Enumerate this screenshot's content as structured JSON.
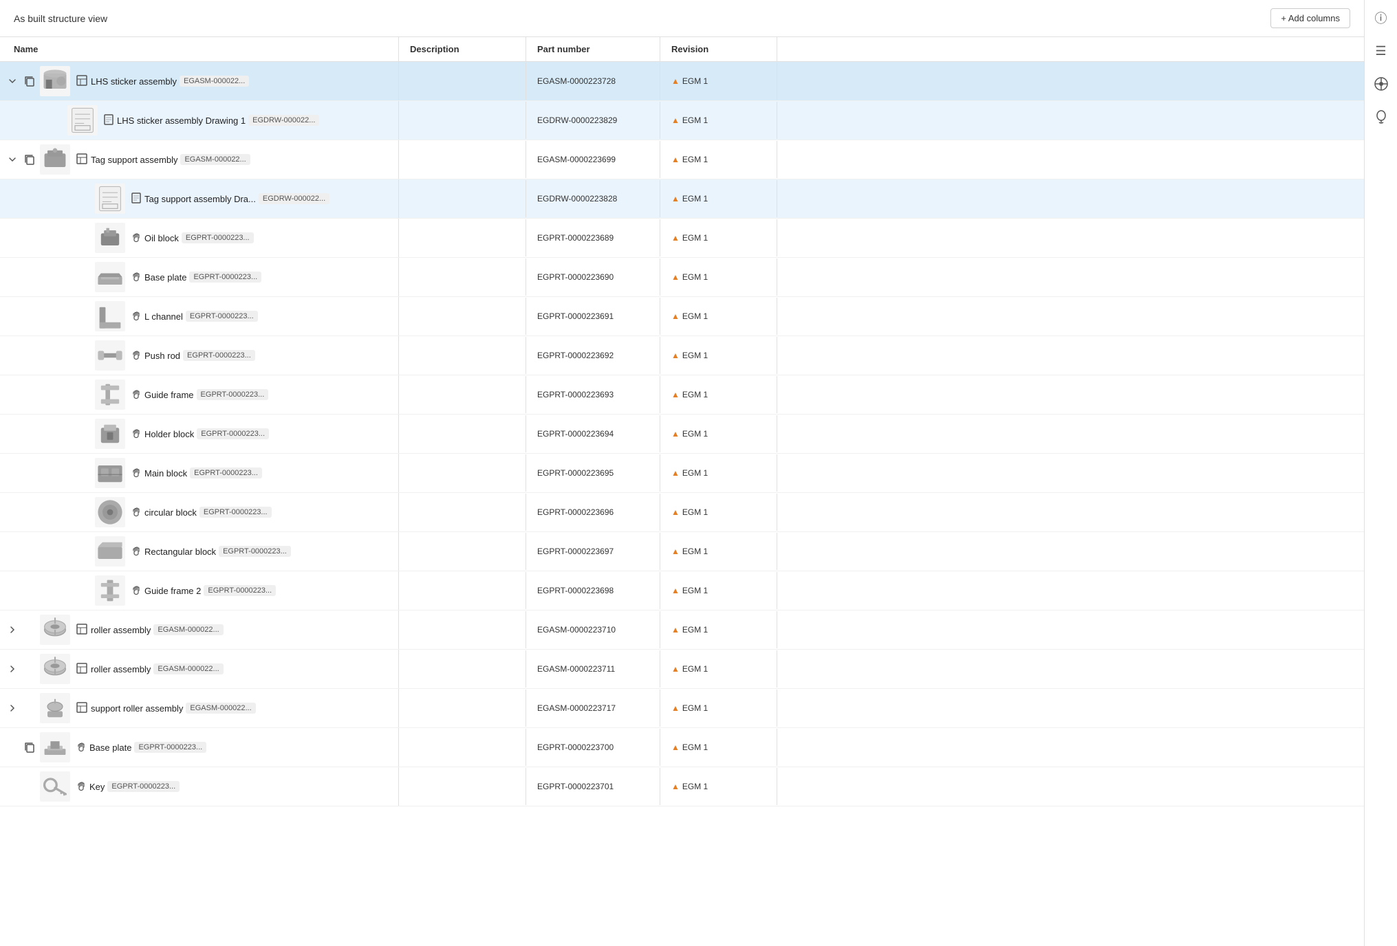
{
  "header": {
    "title": "As built structure view",
    "add_columns_label": "+ Add columns"
  },
  "columns": {
    "name": "Name",
    "description": "Description",
    "part_number": "Part number",
    "revision": "Revision"
  },
  "rows": [
    {
      "id": "lhs-sticker-assembly",
      "level": 0,
      "expanded": true,
      "selected": true,
      "type": "assembly",
      "name": "LHS sticker assembly",
      "tag": "EGASM-000022...",
      "description": "",
      "part_number": "EGASM-0000223728",
      "revision": "EGM 1",
      "has_copy": true,
      "has_children": true,
      "thumbnail_type": "assembly-3d"
    },
    {
      "id": "lhs-sticker-drawing",
      "level": 1,
      "expanded": false,
      "selected": false,
      "highlighted": true,
      "type": "drawing",
      "name": "LHS sticker assembly Drawing 1",
      "tag": "EGDRW-000022...",
      "description": "",
      "part_number": "EGDRW-0000223829",
      "revision": "EGM 1",
      "has_copy": false,
      "has_children": false,
      "thumbnail_type": "drawing"
    },
    {
      "id": "tag-support-assembly",
      "level": 0,
      "expanded": true,
      "selected": false,
      "type": "assembly",
      "name": "Tag support assembly",
      "tag": "EGASM-000022...",
      "description": "",
      "part_number": "EGASM-0000223699",
      "revision": "EGM 1",
      "has_copy": true,
      "has_children": true,
      "thumbnail_type": "tag-assembly"
    },
    {
      "id": "tag-support-drawing",
      "level": 2,
      "expanded": false,
      "selected": false,
      "highlighted": true,
      "type": "drawing",
      "name": "Tag support assembly Dra...",
      "tag": "EGDRW-000022...",
      "description": "",
      "part_number": "EGDRW-0000223828",
      "revision": "EGM 1",
      "has_copy": false,
      "has_children": false,
      "thumbnail_type": "drawing"
    },
    {
      "id": "oil-block",
      "level": 2,
      "expanded": false,
      "selected": false,
      "type": "part",
      "name": "Oil block",
      "tag": "EGPRT-0000223...",
      "description": "",
      "part_number": "EGPRT-0000223689",
      "revision": "EGM 1",
      "has_copy": false,
      "has_children": false,
      "thumbnail_type": "oil-block"
    },
    {
      "id": "base-plate",
      "level": 2,
      "expanded": false,
      "selected": false,
      "type": "part",
      "name": "Base plate",
      "tag": "EGPRT-0000223...",
      "description": "",
      "part_number": "EGPRT-0000223690",
      "revision": "EGM 1",
      "has_copy": false,
      "has_children": false,
      "thumbnail_type": "base-plate"
    },
    {
      "id": "l-channel",
      "level": 2,
      "expanded": false,
      "selected": false,
      "type": "part",
      "name": "L channel",
      "tag": "EGPRT-0000223...",
      "description": "",
      "part_number": "EGPRT-0000223691",
      "revision": "EGM 1",
      "has_copy": false,
      "has_children": false,
      "thumbnail_type": "l-channel"
    },
    {
      "id": "push-rod",
      "level": 2,
      "expanded": false,
      "selected": false,
      "type": "part",
      "name": "Push rod",
      "tag": "EGPRT-0000223...",
      "description": "",
      "part_number": "EGPRT-0000223692",
      "revision": "EGM 1",
      "has_copy": false,
      "has_children": false,
      "thumbnail_type": "push-rod"
    },
    {
      "id": "guide-frame",
      "level": 2,
      "expanded": false,
      "selected": false,
      "type": "part",
      "name": "Guide frame",
      "tag": "EGPRT-0000223...",
      "description": "",
      "part_number": "EGPRT-0000223693",
      "revision": "EGM 1",
      "has_copy": false,
      "has_children": false,
      "thumbnail_type": "guide-frame"
    },
    {
      "id": "holder-block",
      "level": 2,
      "expanded": false,
      "selected": false,
      "type": "part",
      "name": "Holder block",
      "tag": "EGPRT-0000223...",
      "description": "",
      "part_number": "EGPRT-0000223694",
      "revision": "EGM 1",
      "has_copy": false,
      "has_children": false,
      "thumbnail_type": "holder-block"
    },
    {
      "id": "main-block",
      "level": 2,
      "expanded": false,
      "selected": false,
      "type": "part",
      "name": "Main block",
      "tag": "EGPRT-0000223...",
      "description": "",
      "part_number": "EGPRT-0000223695",
      "revision": "EGM 1",
      "has_copy": false,
      "has_children": false,
      "thumbnail_type": "main-block"
    },
    {
      "id": "circular-block",
      "level": 2,
      "expanded": false,
      "selected": false,
      "type": "part",
      "name": "circular block",
      "tag": "EGPRT-0000223...",
      "description": "",
      "part_number": "EGPRT-0000223696",
      "revision": "EGM 1",
      "has_copy": false,
      "has_children": false,
      "thumbnail_type": "circular-block"
    },
    {
      "id": "rectangular-block",
      "level": 2,
      "expanded": false,
      "selected": false,
      "type": "part",
      "name": "Rectangular block",
      "tag": "EGPRT-0000223...",
      "description": "",
      "part_number": "EGPRT-0000223697",
      "revision": "EGM 1",
      "has_copy": false,
      "has_children": false,
      "thumbnail_type": "rectangular-block"
    },
    {
      "id": "guide-frame-2",
      "level": 2,
      "expanded": false,
      "selected": false,
      "type": "part",
      "name": "Guide frame 2",
      "tag": "EGPRT-0000223...",
      "description": "",
      "part_number": "EGPRT-0000223698",
      "revision": "EGM 1",
      "has_copy": false,
      "has_children": false,
      "thumbnail_type": "guide-frame-2"
    },
    {
      "id": "roller-assembly-1",
      "level": 0,
      "expanded": false,
      "selected": false,
      "type": "assembly",
      "name": "roller assembly",
      "tag": "EGASM-000022...",
      "description": "",
      "part_number": "EGASM-0000223710",
      "revision": "EGM 1",
      "has_copy": false,
      "has_children": true,
      "thumbnail_type": "roller-assembly"
    },
    {
      "id": "roller-assembly-2",
      "level": 0,
      "expanded": false,
      "selected": false,
      "type": "assembly",
      "name": "roller assembly",
      "tag": "EGASM-000022...",
      "description": "",
      "part_number": "EGASM-0000223711",
      "revision": "EGM 1",
      "has_copy": false,
      "has_children": true,
      "thumbnail_type": "roller-assembly"
    },
    {
      "id": "support-roller-assembly",
      "level": 0,
      "expanded": false,
      "selected": false,
      "type": "assembly",
      "name": "support roller assembly",
      "tag": "EGASM-000022...",
      "description": "",
      "part_number": "EGASM-0000223717",
      "revision": "EGM 1",
      "has_copy": false,
      "has_children": true,
      "thumbnail_type": "support-roller"
    },
    {
      "id": "base-plate-2",
      "level": 0,
      "expanded": false,
      "selected": false,
      "type": "part",
      "name": "Base plate",
      "tag": "EGPRT-0000223...",
      "description": "",
      "part_number": "EGPRT-0000223700",
      "revision": "EGM 1",
      "has_copy": true,
      "has_children": false,
      "thumbnail_type": "base-plate-small"
    },
    {
      "id": "key",
      "level": 0,
      "expanded": false,
      "selected": false,
      "type": "part",
      "name": "Key",
      "tag": "EGPRT-0000223...",
      "description": "",
      "part_number": "EGPRT-0000223701",
      "revision": "EGM 1",
      "has_copy": false,
      "has_children": false,
      "thumbnail_type": "key"
    }
  ],
  "sidebar_icons": [
    "info",
    "list",
    "connection",
    "alert"
  ]
}
